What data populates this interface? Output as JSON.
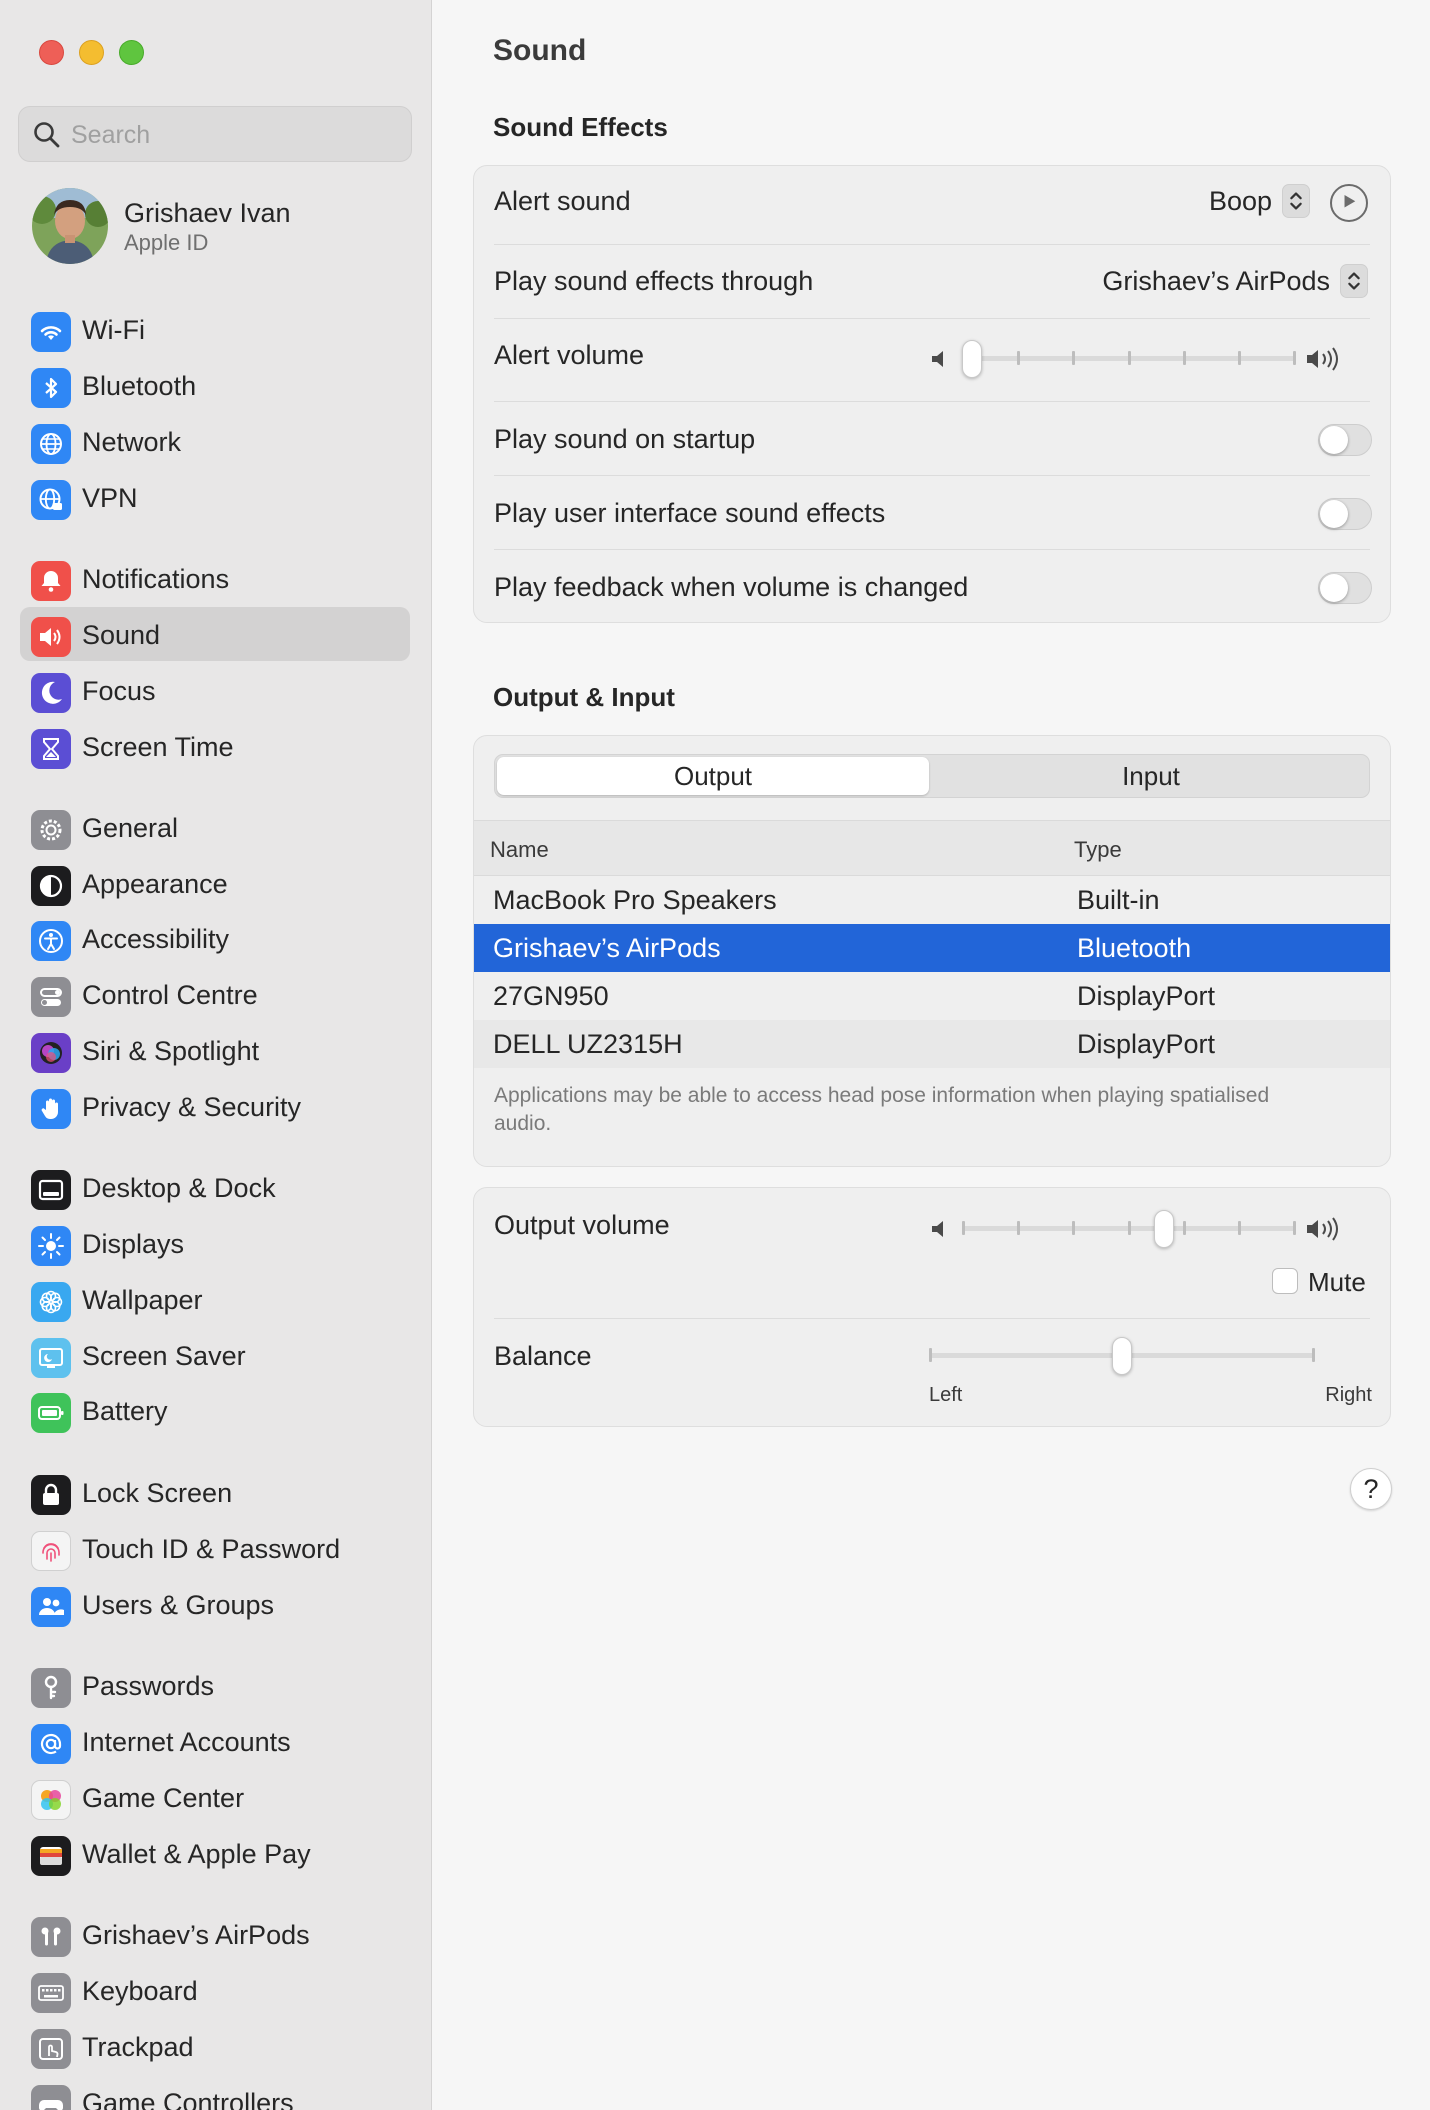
{
  "window": {
    "title": "Sound"
  },
  "search": {
    "placeholder": "Search"
  },
  "profile": {
    "name": "Grishaev Ivan",
    "subtitle": "Apple ID"
  },
  "sidebar": {
    "items": [
      {
        "label": "Wi-Fi",
        "icon": "wifi-icon",
        "color": "#2f87f5"
      },
      {
        "label": "Bluetooth",
        "icon": "bluetooth-icon",
        "color": "#2f87f5"
      },
      {
        "label": "Network",
        "icon": "globe-icon",
        "color": "#2f87f5"
      },
      {
        "label": "VPN",
        "icon": "vpn-globe-icon",
        "color": "#2f87f5"
      },
      {
        "label": "Notifications",
        "icon": "bell-icon",
        "color": "#f0504a"
      },
      {
        "label": "Sound",
        "icon": "speaker-icon",
        "color": "#f0504a",
        "selected": true
      },
      {
        "label": "Focus",
        "icon": "moon-icon",
        "color": "#5b4ed4"
      },
      {
        "label": "Screen Time",
        "icon": "hourglass-icon",
        "color": "#5b4ed4"
      },
      {
        "label": "General",
        "icon": "gear-icon",
        "color": "#8e8e93"
      },
      {
        "label": "Appearance",
        "icon": "appearance-icon",
        "color": "#1c1c1e"
      },
      {
        "label": "Accessibility",
        "icon": "accessibility-icon",
        "color": "#2f87f5"
      },
      {
        "label": "Control Centre",
        "icon": "control-centre-icon",
        "color": "#8e8e93"
      },
      {
        "label": "Siri & Spotlight",
        "icon": "siri-icon",
        "color": "#6a3fc7"
      },
      {
        "label": "Privacy & Security",
        "icon": "hand-icon",
        "color": "#2f87f5"
      },
      {
        "label": "Desktop & Dock",
        "icon": "dock-icon",
        "color": "#1c1c1e"
      },
      {
        "label": "Displays",
        "icon": "sun-icon",
        "color": "#2f87f5"
      },
      {
        "label": "Wallpaper",
        "icon": "flower-icon",
        "color": "#39a8f0"
      },
      {
        "label": "Screen Saver",
        "icon": "screensaver-icon",
        "color": "#5ec1ee"
      },
      {
        "label": "Battery",
        "icon": "battery-icon",
        "color": "#3fc35a"
      },
      {
        "label": "Lock Screen",
        "icon": "lock-icon",
        "color": "#1c1c1e"
      },
      {
        "label": "Touch ID & Password",
        "icon": "fingerprint-icon",
        "color": "#f4f4f4"
      },
      {
        "label": "Users & Groups",
        "icon": "users-icon",
        "color": "#2f87f5"
      },
      {
        "label": "Passwords",
        "icon": "key-icon",
        "color": "#8e8e93"
      },
      {
        "label": "Internet Accounts",
        "icon": "at-icon",
        "color": "#2f87f5"
      },
      {
        "label": "Game Center",
        "icon": "game-center-icon",
        "color": "#f4f4f4"
      },
      {
        "label": "Wallet & Apple Pay",
        "icon": "wallet-icon",
        "color": "#1c1c1e"
      },
      {
        "label": "Grishaev’s AirPods",
        "icon": "airpods-icon",
        "color": "#8e8e93"
      },
      {
        "label": "Keyboard",
        "icon": "keyboard-icon",
        "color": "#8e8e93"
      },
      {
        "label": "Trackpad",
        "icon": "trackpad-icon",
        "color": "#8e8e93"
      },
      {
        "label": "Game Controllers",
        "icon": "gamepad-icon",
        "color": "#8e8e93"
      }
    ]
  },
  "sound_effects": {
    "title": "Sound Effects",
    "alert_sound_label": "Alert sound",
    "alert_sound_value": "Boop",
    "play_through_label": "Play sound effects through",
    "play_through_value": "Grishaev’s AirPods",
    "alert_volume_label": "Alert volume",
    "alert_volume_level": 0.0,
    "startup_label": "Play sound on startup",
    "startup_on": false,
    "ui_effects_label": "Play user interface sound effects",
    "ui_effects_on": false,
    "feedback_label": "Play feedback when volume is changed",
    "feedback_on": false
  },
  "output_input": {
    "title": "Output & Input",
    "tabs": [
      "Output",
      "Input"
    ],
    "active_tab": "Output",
    "columns": [
      "Name",
      "Type"
    ],
    "devices": [
      {
        "name": "MacBook Pro Speakers",
        "type": "Built-in"
      },
      {
        "name": "Grishaev’s AirPods",
        "type": "Bluetooth",
        "selected": true
      },
      {
        "name": "27GN950",
        "type": "DisplayPort"
      },
      {
        "name": "DELL UZ2315H",
        "type": "DisplayPort"
      }
    ],
    "note": "Applications may be able to access head pose information when playing spatialised audio."
  },
  "output_controls": {
    "volume_label": "Output volume",
    "volume_level": 0.61,
    "mute_label": "Mute",
    "mute_checked": false,
    "balance_label": "Balance",
    "balance_level": 0.5,
    "balance_left": "Left",
    "balance_right": "Right"
  },
  "help": {
    "label": "?"
  },
  "colors": {
    "accent": "#2265d8",
    "selected_sidebar": "#d3d2d2"
  }
}
